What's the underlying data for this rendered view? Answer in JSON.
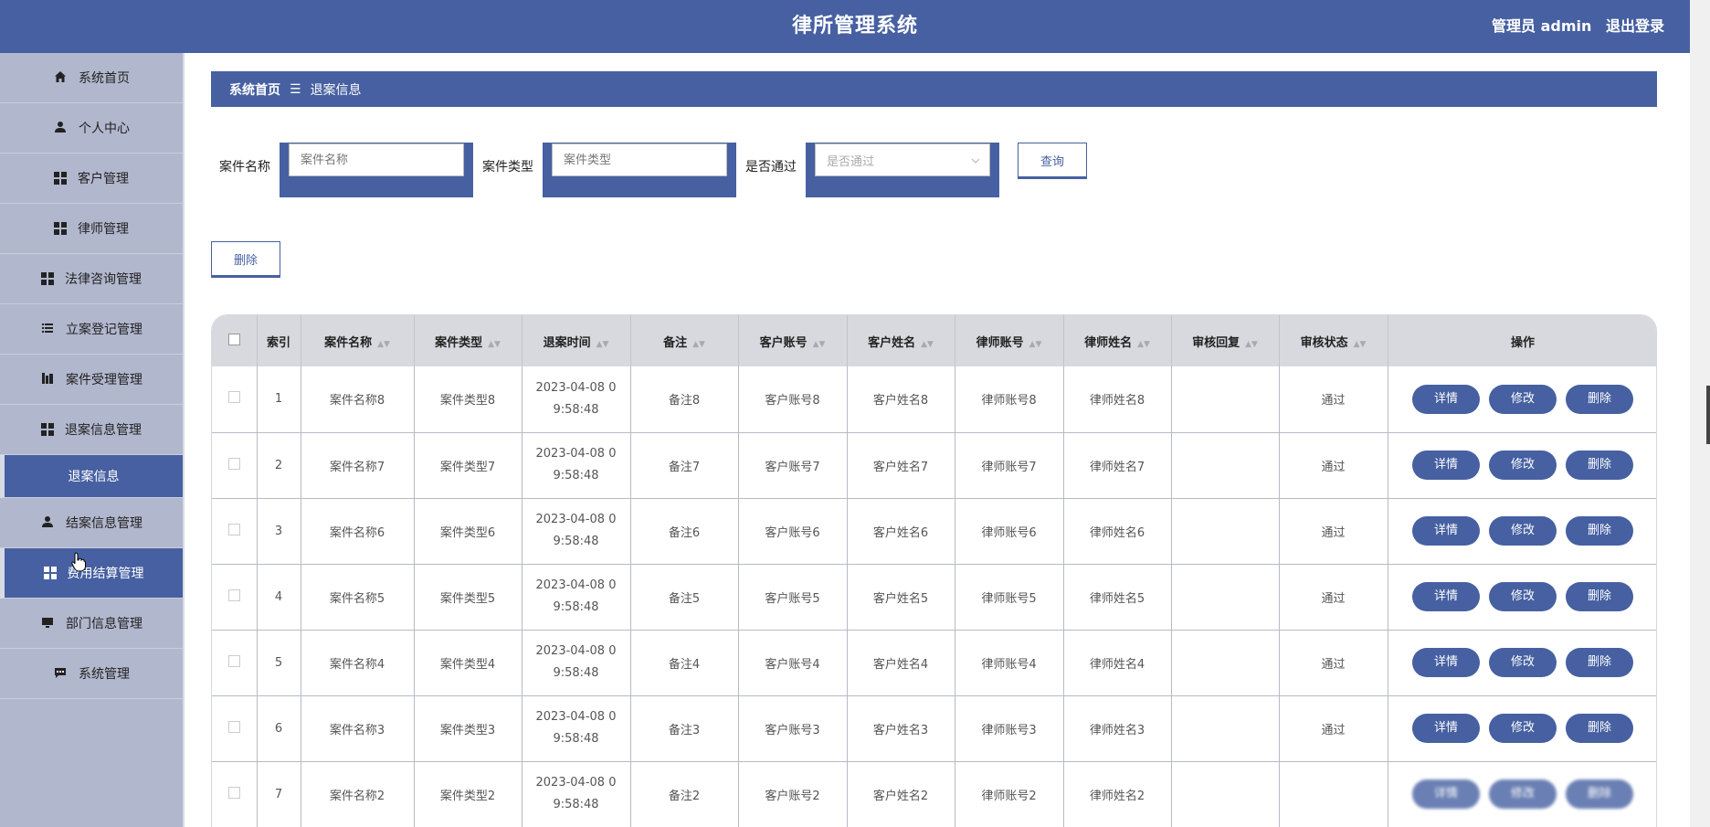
{
  "header": {
    "title": "律所管理系统",
    "user_label": "管理员 admin",
    "logout_label": "退出登录"
  },
  "sidebar": {
    "items": [
      {
        "label": "系统首页",
        "icon": "home-icon"
      },
      {
        "label": "个人中心",
        "icon": "person-icon"
      },
      {
        "label": "客户管理",
        "icon": "grid-icon"
      },
      {
        "label": "律师管理",
        "icon": "grid-icon"
      },
      {
        "label": "法律咨询管理",
        "icon": "grid-icon"
      },
      {
        "label": "立案登记管理",
        "icon": "list-icon"
      },
      {
        "label": "案件受理管理",
        "icon": "chart-icon"
      },
      {
        "label": "退案信息管理",
        "icon": "grid-icon"
      },
      {
        "label": "退案信息",
        "icon": ""
      },
      {
        "label": "结案信息管理",
        "icon": "person-icon"
      },
      {
        "label": "费用结算管理",
        "icon": "grid-icon"
      },
      {
        "label": "部门信息管理",
        "icon": "monitor-icon"
      },
      {
        "label": "系统管理",
        "icon": "chat-icon"
      }
    ]
  },
  "breadcrumb": {
    "home": "系统首页",
    "separator": "☰",
    "current": "退案信息"
  },
  "search": {
    "case_name_label": "案件名称",
    "case_name_placeholder": "案件名称",
    "case_type_label": "案件类型",
    "case_type_placeholder": "案件类型",
    "passed_label": "是否通过",
    "passed_placeholder": "是否通过",
    "query_label": "查询"
  },
  "actions": {
    "delete_label": "删除"
  },
  "table": {
    "headers": [
      "索引",
      "案件名称",
      "案件类型",
      "退案时间",
      "备注",
      "客户账号",
      "客户姓名",
      "律师账号",
      "律师姓名",
      "审核回复",
      "审核状态",
      "操作"
    ],
    "op_labels": {
      "detail": "详情",
      "edit": "修改",
      "delete": "删除"
    },
    "rows": [
      {
        "index": "1",
        "case_name": "案件名称8",
        "case_type": "案件类型8",
        "time_a": "2023-04-08 0",
        "time_b": "9:58:48",
        "note": "备注8",
        "client_account": "客户账号8",
        "client_name": "客户姓名8",
        "lawyer_account": "律师账号8",
        "lawyer_name": "律师姓名8",
        "reply": "",
        "status": "通过"
      },
      {
        "index": "2",
        "case_name": "案件名称7",
        "case_type": "案件类型7",
        "time_a": "2023-04-08 0",
        "time_b": "9:58:48",
        "note": "备注7",
        "client_account": "客户账号7",
        "client_name": "客户姓名7",
        "lawyer_account": "律师账号7",
        "lawyer_name": "律师姓名7",
        "reply": "",
        "status": "通过"
      },
      {
        "index": "3",
        "case_name": "案件名称6",
        "case_type": "案件类型6",
        "time_a": "2023-04-08 0",
        "time_b": "9:58:48",
        "note": "备注6",
        "client_account": "客户账号6",
        "client_name": "客户姓名6",
        "lawyer_account": "律师账号6",
        "lawyer_name": "律师姓名6",
        "reply": "",
        "status": "通过"
      },
      {
        "index": "4",
        "case_name": "案件名称5",
        "case_type": "案件类型5",
        "time_a": "2023-04-08 0",
        "time_b": "9:58:48",
        "note": "备注5",
        "client_account": "客户账号5",
        "client_name": "客户姓名5",
        "lawyer_account": "律师账号5",
        "lawyer_name": "律师姓名5",
        "reply": "",
        "status": "通过"
      },
      {
        "index": "5",
        "case_name": "案件名称4",
        "case_type": "案件类型4",
        "time_a": "2023-04-08 0",
        "time_b": "9:58:48",
        "note": "备注4",
        "client_account": "客户账号4",
        "client_name": "客户姓名4",
        "lawyer_account": "律师账号4",
        "lawyer_name": "律师姓名4",
        "reply": "",
        "status": "通过"
      },
      {
        "index": "6",
        "case_name": "案件名称3",
        "case_type": "案件类型3",
        "time_a": "2023-04-08 0",
        "time_b": "9:58:48",
        "note": "备注3",
        "client_account": "客户账号3",
        "client_name": "客户姓名3",
        "lawyer_account": "律师账号3",
        "lawyer_name": "律师姓名3",
        "reply": "",
        "status": "通过"
      },
      {
        "index": "7",
        "case_name": "案件名称2",
        "case_type": "案件类型2",
        "time_a": "2023-04-08 0",
        "time_b": "9:58:48",
        "note": "备注2",
        "client_account": "客户账号2",
        "client_name": "客户姓名2",
        "lawyer_account": "律师账号2",
        "lawyer_name": "律师姓名2",
        "reply": "",
        "status": ""
      }
    ]
  },
  "colors": {
    "primary": "#4660a1",
    "sidebar_bg": "#b1b7cd",
    "table_header_bg": "#d8d9de"
  }
}
